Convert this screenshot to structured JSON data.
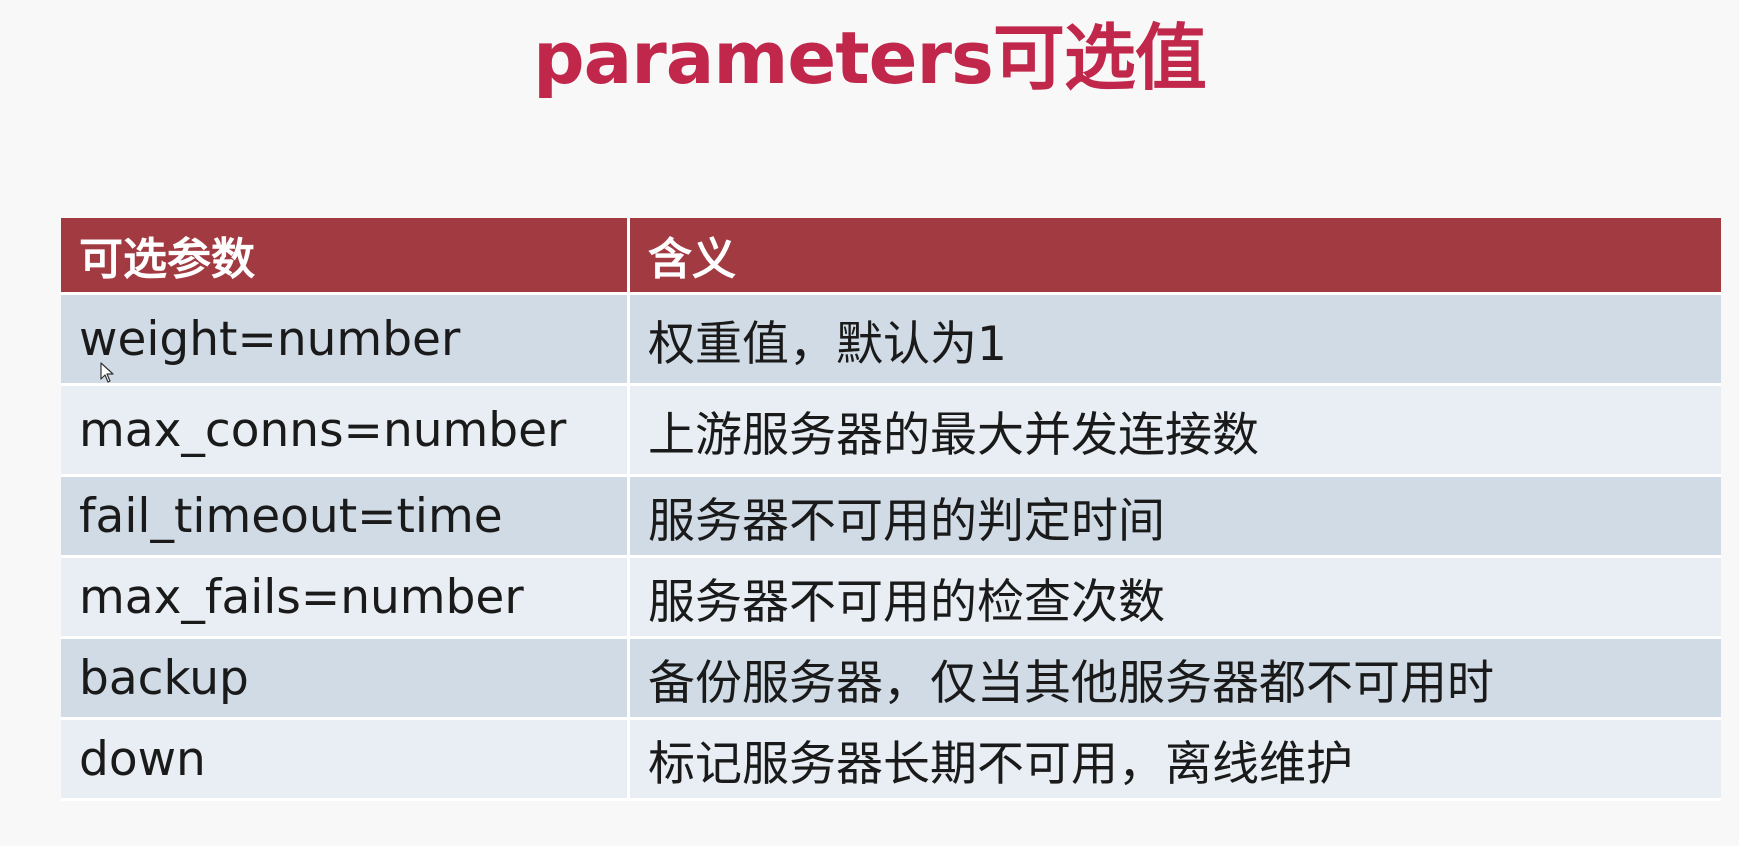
{
  "title": "parameters可选值",
  "table": {
    "headers": [
      "可选参数",
      "含义"
    ],
    "rows": [
      {
        "param": "weight=number",
        "meaning": "权重值，默认为1"
      },
      {
        "param": "max_conns=number",
        "meaning": "上游服务器的最大并发连接数"
      },
      {
        "param": "fail_timeout=time",
        "meaning": "服务器不可用的判定时间"
      },
      {
        "param": "max_fails=number",
        "meaning": "服务器不可用的检查次数"
      },
      {
        "param": "backup",
        "meaning": "备份服务器，仅当其他服务器都不可用时"
      },
      {
        "param": "down",
        "meaning": "标记服务器长期不可用，离线维护"
      }
    ]
  },
  "colors": {
    "title": "#c0274a",
    "header_bg": "#a23a42",
    "row_dark": "#d0dbe5",
    "row_light": "#e8eef3"
  },
  "icons": {
    "cursor": "mouse-pointer-icon"
  }
}
